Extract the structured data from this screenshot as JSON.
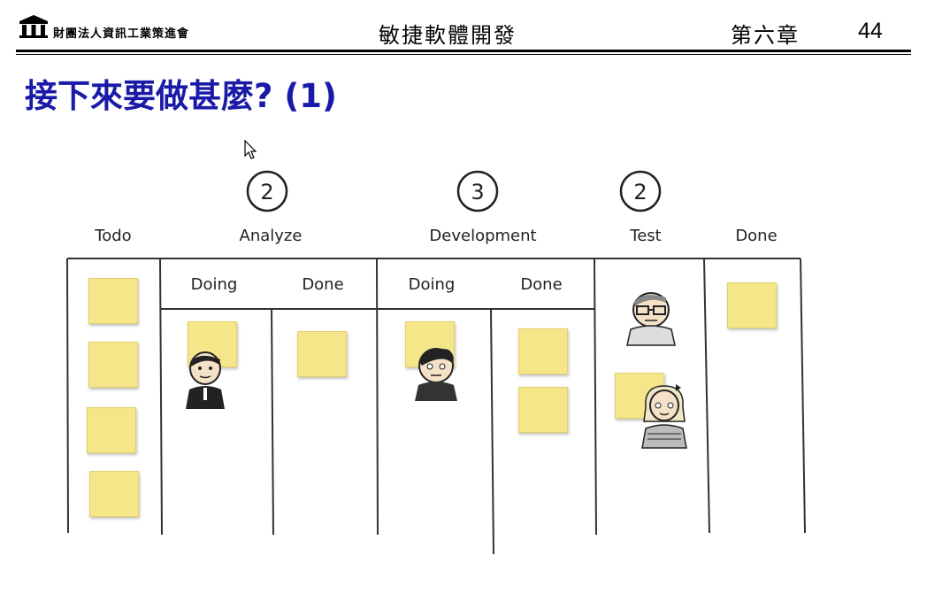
{
  "header": {
    "org": "財團法人資訊工業策進會",
    "course": "敏捷軟體開發",
    "chapter": "第六章",
    "page_number": "44"
  },
  "title": "接下來要做甚麼? (1)",
  "board": {
    "columns": [
      {
        "label": "Todo",
        "wip": ""
      },
      {
        "label": "Analyze",
        "wip": "2",
        "sub": [
          "Doing",
          "Done"
        ]
      },
      {
        "label": "Development",
        "wip": "3",
        "sub": [
          "Doing",
          "Done"
        ]
      },
      {
        "label": "Test",
        "wip": "2"
      },
      {
        "label": "Done",
        "wip": ""
      }
    ]
  },
  "colors": {
    "note": "#f5e68a",
    "title": "#1a1aa8"
  }
}
